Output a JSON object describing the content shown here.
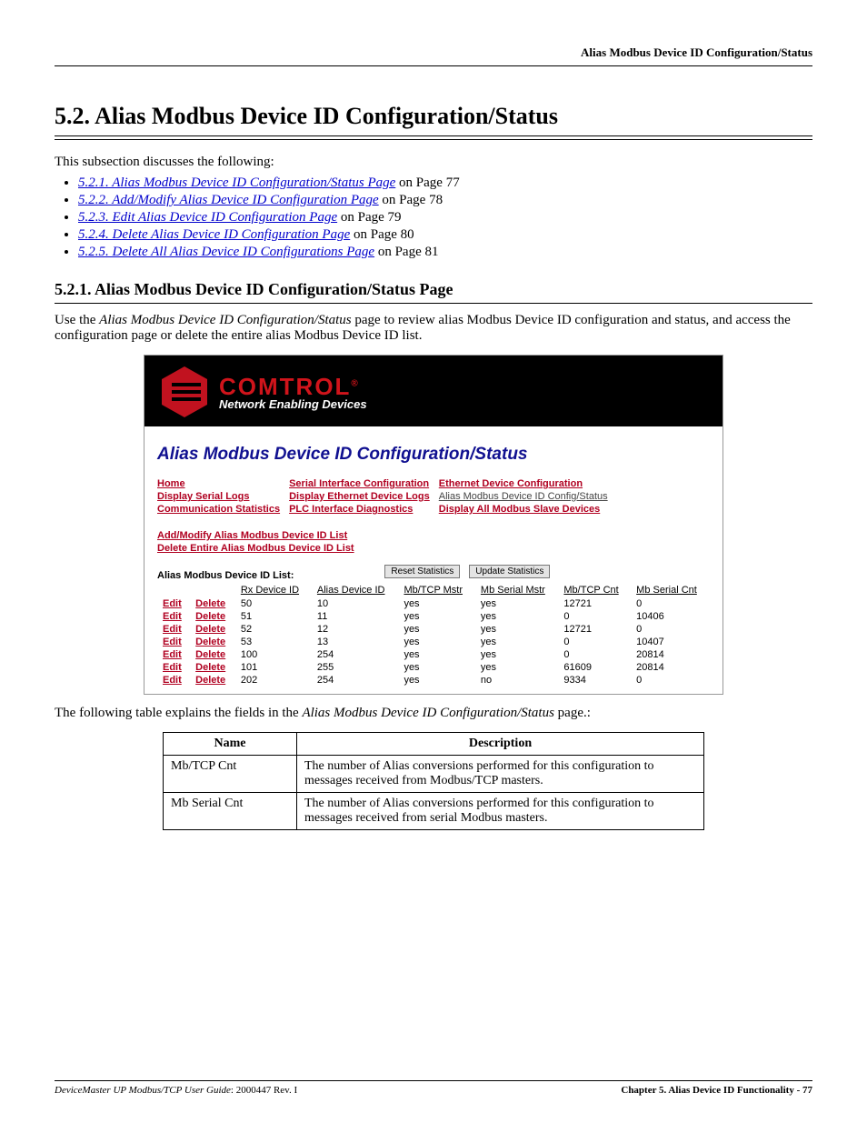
{
  "running_header": "Alias Modbus Device ID Configuration/Status",
  "section_title": "5.2. Alias Modbus Device ID Configuration/Status",
  "intro": "This subsection discusses the following:",
  "toc": [
    {
      "link": "5.2.1. Alias Modbus Device ID Configuration/Status Page",
      "suffix": " on Page 77"
    },
    {
      "link": "5.2.2. Add/Modify Alias Device ID Configuration Page",
      "suffix": " on Page 78"
    },
    {
      "link": "5.2.3. Edit Alias Device ID Configuration Page",
      "suffix": " on Page 79"
    },
    {
      "link": "5.2.4. Delete Alias Device ID Configuration Page",
      "suffix": " on Page 80"
    },
    {
      "link": "5.2.5. Delete All Alias Device ID Configurations Page",
      "suffix": " on Page 81"
    }
  ],
  "subsection_title": "5.2.1. Alias Modbus Device ID Configuration/Status Page",
  "subsection_body_pre": "Use the ",
  "subsection_body_em": "Alias Modbus Device ID Configuration/Status",
  "subsection_body_post": " page to review alias Modbus Device ID configuration and status, and access the configuration page or delete the entire alias Modbus Device ID list.",
  "screenshot": {
    "brand_name": "COMTROL",
    "brand_tag": "Network Enabling Devices",
    "heading": "Alias Modbus Device ID Configuration/Status",
    "nav": [
      [
        "Home",
        "Serial Interface Configuration",
        "Ethernet Device Configuration"
      ],
      [
        "Display Serial Logs",
        "Display Ethernet Device Logs",
        "Alias Modbus Device ID Config/Status"
      ],
      [
        "Communication Statistics",
        "PLC Interface Diagnostics",
        "Display All Modbus Slave Devices"
      ]
    ],
    "nav_current_row": 1,
    "nav_current_col": 2,
    "actions": {
      "add": "Add/Modify Alias Modbus Device ID List",
      "delete_all": "Delete Entire Alias Modbus Device ID List"
    },
    "list_label": "Alias Modbus Device ID List:",
    "buttons": {
      "reset": "Reset Statistics",
      "update": "Update Statistics"
    },
    "row_actions": {
      "edit": "Edit",
      "delete": "Delete"
    },
    "columns": [
      "Rx Device ID",
      "Alias Device ID",
      "Mb/TCP Mstr",
      "Mb Serial Mstr",
      "Mb/TCP Cnt",
      "Mb Serial Cnt"
    ],
    "rows": [
      {
        "rx": "50",
        "alias": "10",
        "tcp": "yes",
        "serial": "yes",
        "tcpcnt": "12721",
        "serialcnt": "0"
      },
      {
        "rx": "51",
        "alias": "11",
        "tcp": "yes",
        "serial": "yes",
        "tcpcnt": "0",
        "serialcnt": "10406"
      },
      {
        "rx": "52",
        "alias": "12",
        "tcp": "yes",
        "serial": "yes",
        "tcpcnt": "12721",
        "serialcnt": "0"
      },
      {
        "rx": "53",
        "alias": "13",
        "tcp": "yes",
        "serial": "yes",
        "tcpcnt": "0",
        "serialcnt": "10407"
      },
      {
        "rx": "100",
        "alias": "254",
        "tcp": "yes",
        "serial": "yes",
        "tcpcnt": "0",
        "serialcnt": "20814"
      },
      {
        "rx": "101",
        "alias": "255",
        "tcp": "yes",
        "serial": "yes",
        "tcpcnt": "61609",
        "serialcnt": "20814"
      },
      {
        "rx": "202",
        "alias": "254",
        "tcp": "yes",
        "serial": "no",
        "tcpcnt": "9334",
        "serialcnt": "0"
      }
    ]
  },
  "after_screenshot_pre": "The following table explains the fields in the ",
  "after_screenshot_em": "Alias Modbus Device ID Configuration/Status",
  "after_screenshot_post": " page.:",
  "field_table": {
    "headers": [
      "Name",
      "Description"
    ],
    "rows": [
      {
        "name": "Mb/TCP Cnt",
        "desc": "The number of Alias conversions performed for this configuration to messages received from Modbus/TCP masters."
      },
      {
        "name": "Mb Serial Cnt",
        "desc": "The number of Alias conversions performed for this configuration to messages received from serial Modbus masters."
      }
    ]
  },
  "footer": {
    "left_em": "DeviceMaster UP Modbus/TCP User Guide",
    "left_rest": ": 2000447 Rev. I",
    "right": "Chapter 5. Alias Device ID Functionality - 77"
  }
}
